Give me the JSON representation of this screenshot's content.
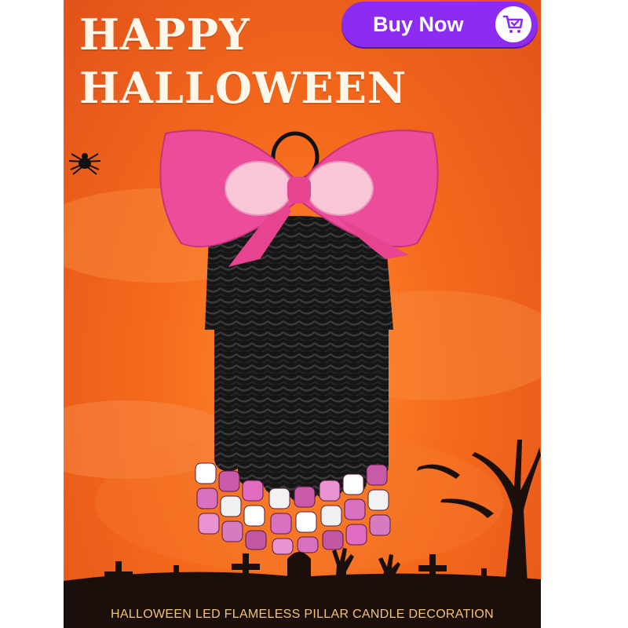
{
  "ad": {
    "headline_line1": "HAPPY",
    "headline_line2": "HALLOWEEN",
    "buy_button_label": "Buy Now",
    "footer_caption": "HALLOWEEN LED FLAMELESS PILLAR CANDLE DECORATION",
    "icons": [
      "cart-icon",
      "spider-icon"
    ],
    "colors": {
      "background": "#f56a1d",
      "headline": "#fff7ea",
      "button": "#8b2cf0",
      "bow": "#ec4d9a",
      "hair": "#141414",
      "caption": "#f3c37a"
    }
  }
}
